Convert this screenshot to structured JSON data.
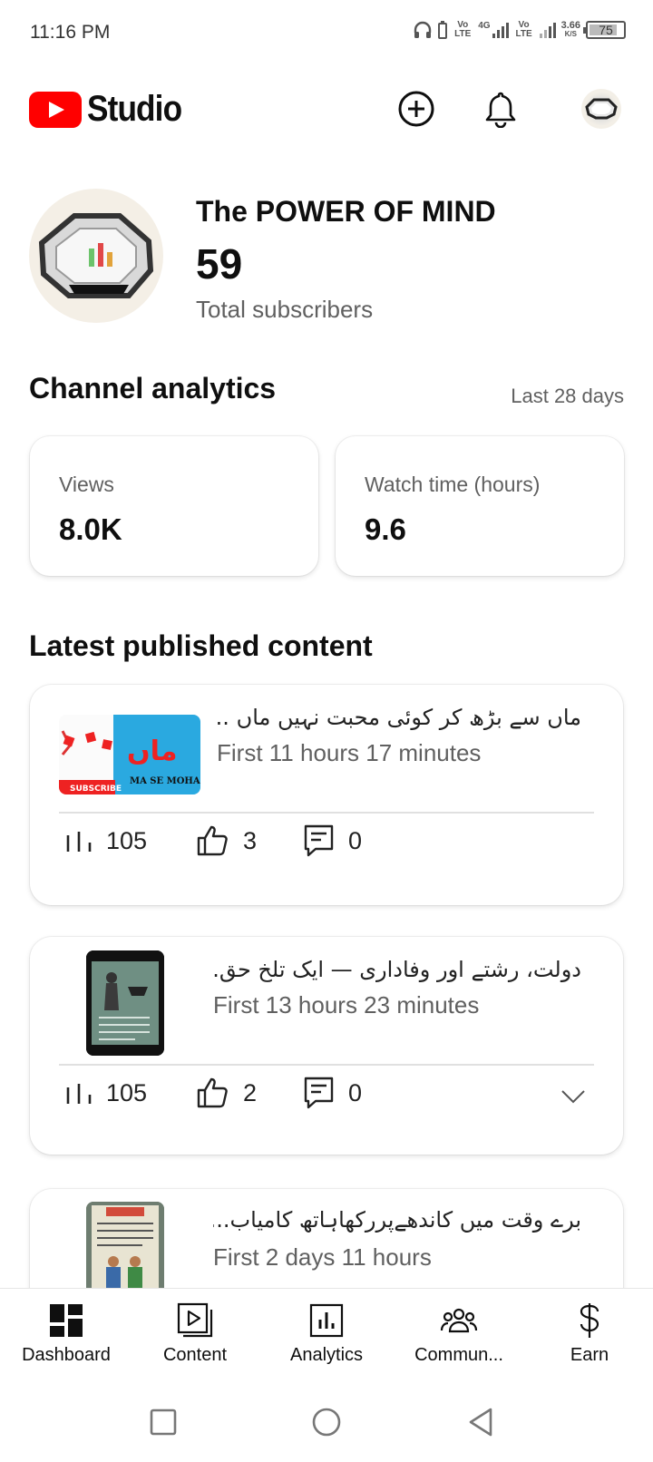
{
  "status_bar": {
    "time": "11:16 PM",
    "volte1": "Vo LTE",
    "network": "4G",
    "volte2": "Vo LTE",
    "speed_value": "3.66",
    "speed_unit": "K/S",
    "battery": "75"
  },
  "header": {
    "app_name": "Studio",
    "create_icon": "add-circle-icon",
    "notifications_icon": "bell-icon"
  },
  "channel": {
    "name": "The POWER OF MIND",
    "subscriber_count": "59",
    "subscriber_label": "Total subscribers"
  },
  "analytics": {
    "title": "Channel analytics",
    "period": "Last 28 days",
    "cards": [
      {
        "label": "Views",
        "value": "8.0K"
      },
      {
        "label": "Watch time (hours)",
        "value": "9.6"
      }
    ]
  },
  "latest": {
    "title": "Latest published content",
    "items": [
      {
        "title": "ماں سے بڑھ کر کوئی محبت نہیں  ماں ...",
        "time": "First 11 hours 17 minutes",
        "views": "105",
        "likes": "3",
        "comments": "0"
      },
      {
        "title": "دولت، رشتے اور وفاداری — ایک تلخ حق...",
        "time": "First 13 hours 23 minutes",
        "views": "105",
        "likes": "2",
        "comments": "0"
      },
      {
        "title": "برے وقت میں کاندھےپررکھاہاتھ کامیاب...",
        "time": "First 2 days 11 hours"
      }
    ],
    "thumb1": {
      "brand": "MA SE MOHAB",
      "subscribe": "SUBSCRIBE",
      "word": "ماں"
    }
  },
  "bottom_nav": [
    {
      "label": "Dashboard"
    },
    {
      "label": "Content"
    },
    {
      "label": "Analytics"
    },
    {
      "label": "Commun..."
    },
    {
      "label": "Earn"
    }
  ],
  "colors": {
    "brand_red": "#ff0000",
    "text_primary": "#0f0f0f",
    "text_secondary": "#606060"
  }
}
